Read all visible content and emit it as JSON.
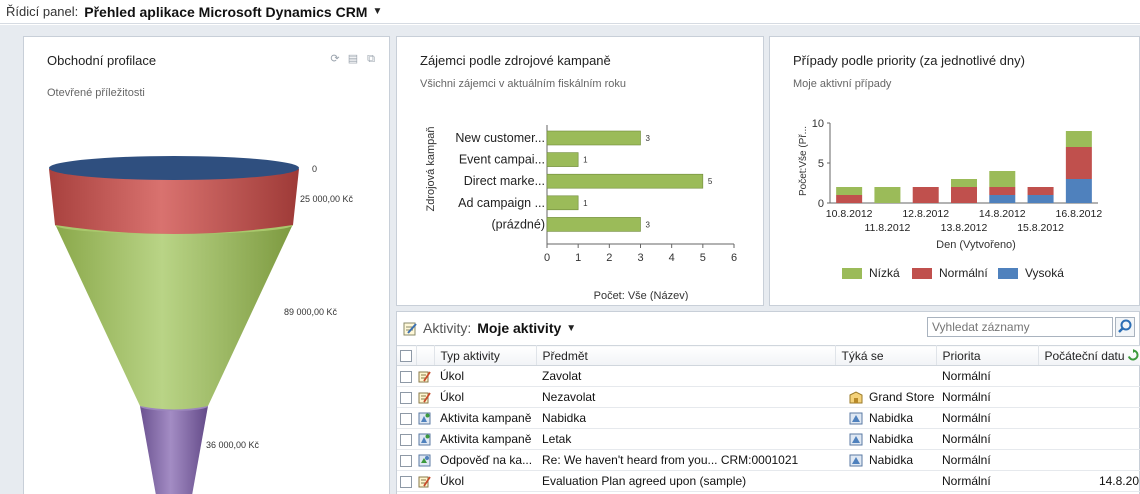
{
  "header": {
    "label": "Řídicí panel:",
    "title": "Přehled aplikace Microsoft Dynamics CRM"
  },
  "funnel": {
    "title": "Obchodní profilace",
    "subtitle": "Otevřené příležitosti",
    "stages": [
      {
        "label": "0",
        "value": 0,
        "color": "#2f4f7f"
      },
      {
        "label": "25 000,00 Kč",
        "value": 25000,
        "color": "#c0504d"
      },
      {
        "label": "89 000,00 Kč",
        "value": 89000,
        "color": "#9bbb59"
      },
      {
        "label": "36 000,00 Kč",
        "value": 36000,
        "color": "#8064a2"
      }
    ],
    "icons": [
      "refresh-icon",
      "view-records-icon",
      "expand-icon"
    ]
  },
  "chart_data": [
    {
      "type": "bar",
      "orientation": "horizontal",
      "title": "Zájemci podle zdrojové kampaně",
      "subtitle": "Všichni zájemci v aktuálním fiskálním roku",
      "categories": [
        "New customer...",
        "Event campai...",
        "Direct marke...",
        "Ad campaign ...",
        "(prázdné)"
      ],
      "values": [
        3,
        1,
        5,
        1,
        3
      ],
      "data_labels": [
        "3",
        "1",
        "5",
        "1",
        "3"
      ],
      "xlabel": "Počet: Vše (Název)",
      "ylabel": "Zdrojová kampaň",
      "xlim": [
        0,
        6
      ],
      "xticks": [
        "0",
        "1",
        "2",
        "3",
        "4",
        "5",
        "6"
      ],
      "color": "#9bbb59",
      "grid": false
    },
    {
      "type": "bar",
      "stacked": true,
      "title": "Případy podle priority (za jednotlivé dny)",
      "subtitle": "Moje aktivní případy",
      "categories": [
        "10.8.2012",
        "11.8.2012",
        "12.8.2012",
        "13.8.2012",
        "14.8.2012",
        "15.8.2012",
        "16.8.2012"
      ],
      "series": [
        {
          "name": "Nízká",
          "color": "#9bbb59",
          "values": [
            1,
            2,
            0,
            1,
            2,
            0,
            2
          ]
        },
        {
          "name": "Normální",
          "color": "#c0504d",
          "values": [
            1,
            0,
            2,
            2,
            1,
            1,
            4
          ]
        },
        {
          "name": "Vysoká",
          "color": "#4f81bd",
          "values": [
            0,
            0,
            0,
            0,
            1,
            1,
            3
          ]
        }
      ],
      "xlabel": "Den (Vytvořeno)",
      "ylabel": "Počet:Vše (Př...",
      "ylim": [
        0,
        10
      ],
      "yticks": [
        "0",
        "5",
        "10"
      ],
      "legend_position": "bottom",
      "grid": false
    }
  ],
  "activities": {
    "label": "Aktivity:",
    "view": "Moje aktivity",
    "search_placeholder": "Vyhledat záznamy",
    "columns": [
      "Typ aktivity",
      "Předmět",
      "Týká se",
      "Priorita",
      "Počáteční datu"
    ],
    "rows": [
      {
        "type": "Úkol",
        "subject": "Zavolat",
        "regarding": "",
        "regarding_icon": "",
        "priority": "Normální",
        "start": "",
        "icon": "task-icon"
      },
      {
        "type": "Úkol",
        "subject": "Nezavolat",
        "regarding": "Grand Store (",
        "regarding_icon": "account-icon",
        "priority": "Normální",
        "start": "",
        "icon": "task-icon"
      },
      {
        "type": "Aktivita kampaně",
        "subject": "Nabidka",
        "regarding": "Nabidka",
        "regarding_icon": "campaign-icon",
        "priority": "Normální",
        "start": "",
        "icon": "campaign-activity-icon"
      },
      {
        "type": "Aktivita kampaně",
        "subject": "Letak",
        "regarding": "Nabidka",
        "regarding_icon": "campaign-icon",
        "priority": "Normální",
        "start": "",
        "icon": "campaign-activity-icon"
      },
      {
        "type": "Odpověď na ka...",
        "subject": "Re: We haven't heard from you... CRM:0001021",
        "regarding": "Nabidka",
        "regarding_icon": "campaign-icon",
        "priority": "Normální",
        "start": "",
        "icon": "campaign-response-icon"
      },
      {
        "type": "Úkol",
        "subject": "Evaluation Plan agreed upon (sample)",
        "regarding": "",
        "regarding_icon": "",
        "priority": "Normální",
        "start": "14.8.20",
        "icon": "task-icon"
      }
    ]
  }
}
